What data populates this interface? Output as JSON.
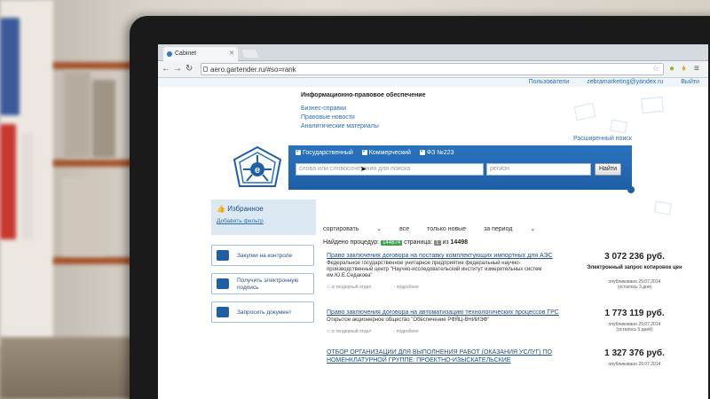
{
  "browser": {
    "tab_title": "Cabinet",
    "url": "aero.gartender.ru/#so=rank"
  },
  "top_links": {
    "users": "Пользователи",
    "email": "zebramarketing@yandex.ru",
    "logout": "Выйти"
  },
  "info": {
    "title": "Информационно-правовое обеспечение",
    "links": [
      "Бизнес-справки",
      "Правовые новости",
      "Аналитические материалы"
    ]
  },
  "search": {
    "advanced": "Расширенный поиск",
    "types": [
      "Государственный",
      "Коммерческий",
      "ФЗ №223"
    ],
    "query_placeholder": "слова или словосочетания для поиска",
    "region_placeholder": "регион",
    "find_label": "Найти"
  },
  "sidebar": {
    "favorites_title": "Избранное",
    "add_filter": "Добавить фильтр",
    "buttons": [
      "Закупки на контроле",
      "Получить электронную подпись",
      "Запросить документ"
    ]
  },
  "filters": {
    "sort": "сортировать",
    "all": "все",
    "new_only": "только новые",
    "period": "за период"
  },
  "found": {
    "label": "Найдено процедур:",
    "count": "144874",
    "page_label": "страница:",
    "page": "1",
    "of_label": "из",
    "total_pages": "14498"
  },
  "results": [
    {
      "title": "Право заключения договора на поставку комплектующих импортных для АЭС",
      "desc": "Федеральное государственное унитарное предприятие федеральный научно-производственный центр \"Научно-исследовательский институт измерительных систем им.Ю.Е.Седакова\"",
      "meta": [
        "в тендерный отдел",
        "подробнее"
      ],
      "price": "3 072 236 руб.",
      "note": "Электронный запрос котировок цен",
      "published": "опубликовано 29.07.2014",
      "remaining": "(осталось 3 дня)"
    },
    {
      "title": "Право заключения договора на автоматизацию технологических процессов ГРС",
      "desc": "Открытое акционерное общество \"Обеспечение РФЯЦ-ВНИИЭФ\"",
      "meta": [
        "в тендерный отдел",
        "подробнее"
      ],
      "price": "1 773 119 руб.",
      "published": "опубликовано 29.07.2014",
      "remaining": "(осталось 5 дней)"
    },
    {
      "title": "ОТБОР ОРГАНИЗАЦИИ ДЛЯ ВЫПОЛНЕНИЯ РАБОТ (ОКАЗАНИЯ УСЛУГ) ПО НОМЕНКЛАТУРНОЙ ГРУППЕ: ПРОЕКТНО-ИЗЫСКАТЕЛЬСКИЕ",
      "price": "1 327 376 руб.",
      "published": "опубликовано 29.07.2014"
    }
  ]
}
